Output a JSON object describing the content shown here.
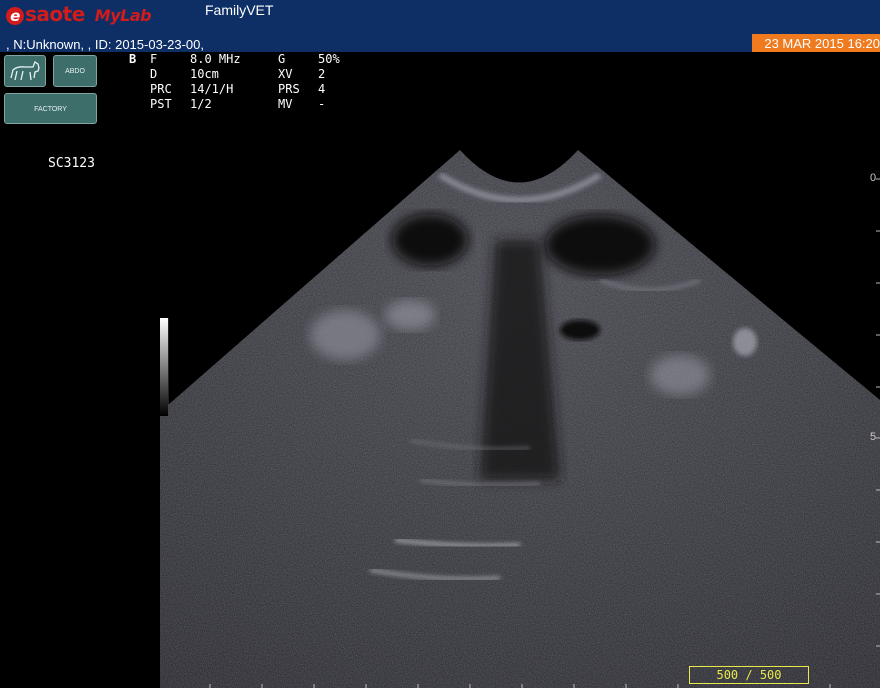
{
  "header": {
    "brand": "saote",
    "brand_mark": "e",
    "product_my": "My",
    "product_lab": "Lab",
    "app_name": "FamilyVET",
    "patient_info": ", N:Unknown, , ID: 2015-03-23-00,",
    "datetime": "23 MAR 2015 16:20",
    "colors": {
      "bar": "#0d2f66",
      "date_bg": "#f07a1e",
      "brand": "#d21b1b"
    }
  },
  "controls": {
    "preset_icon": "dog-icon",
    "abdo_label": "ABDO",
    "factory_label": "FACTORY"
  },
  "imaging": {
    "mode": "B",
    "params": [
      {
        "k1": "F",
        "v1": "8.0 MHz",
        "k2": "G",
        "v2": "50%"
      },
      {
        "k1": "D",
        "v1": "10cm",
        "k2": "XV",
        "v2": "2"
      },
      {
        "k1": "PRC",
        "v1": "14/1/H",
        "k2": "PRS",
        "v2": "4"
      },
      {
        "k1": "PST",
        "v1": "1/2",
        "k2": "MV",
        "v2": "-"
      }
    ],
    "probe": "SC3123",
    "depth_top": "0",
    "depth_mid": "5",
    "frames": "500 / 500"
  }
}
